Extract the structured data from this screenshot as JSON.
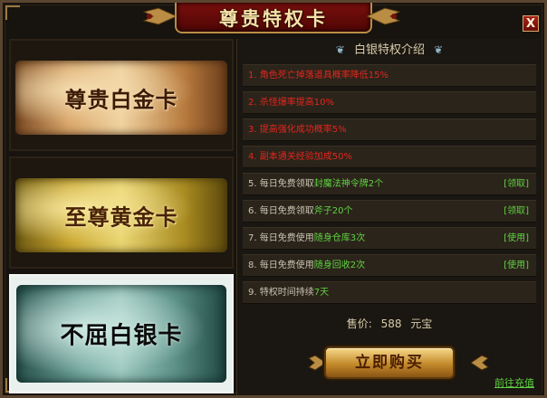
{
  "window": {
    "title": "尊贵特权卡",
    "close_label": "X"
  },
  "cards": [
    {
      "label": "尊贵白金卡"
    },
    {
      "label": "至尊黄金卡"
    },
    {
      "label": "不屈白银卡"
    }
  ],
  "panel": {
    "header": "白银特权介绍",
    "items": [
      {
        "text": "1. 角色死亡掉落道具概率降低15%"
      },
      {
        "text": "2. 杀怪爆率提高10%"
      },
      {
        "text": "3. 提高强化成功概率5%"
      },
      {
        "text": "4. 副本通关经验加成50%"
      },
      {
        "prefix": "5. 每日免费领取",
        "highlight": "封魔法神令牌2个",
        "action": "[领取]"
      },
      {
        "prefix": "6. 每日免费领取",
        "highlight": "斧子20个",
        "action": "[领取]"
      },
      {
        "prefix": "7. 每日免费使用",
        "highlight": "随身仓库3次",
        "action": "[使用]"
      },
      {
        "prefix": "8. 每日免费使用",
        "highlight": "随身回收2次",
        "action": "[使用]"
      },
      {
        "prefix": "9. 特权时间持续",
        "highlight": "7天"
      }
    ],
    "price_label": "售价:",
    "price_value": "588",
    "price_unit": "元宝",
    "buy_label": "立即购买",
    "recharge_link": "前往充值"
  },
  "colors": {
    "red_text": "#e4261e",
    "green_text": "#5fd243",
    "title_plate": "#7a0f0c"
  }
}
